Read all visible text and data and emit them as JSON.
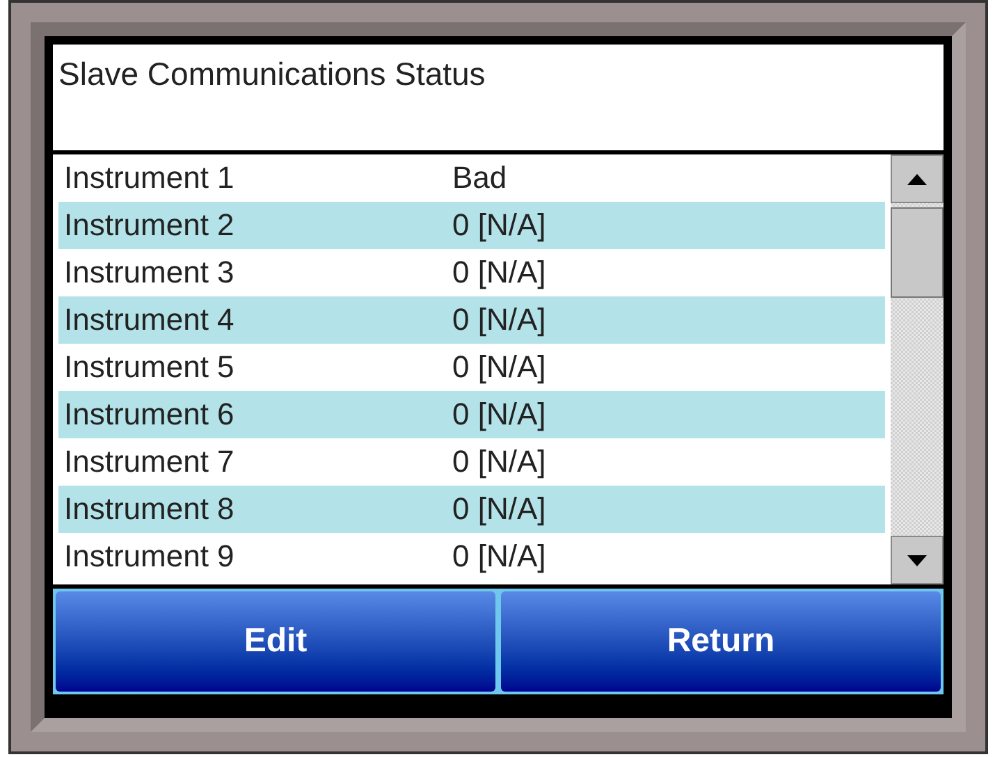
{
  "title": "Slave Communications Status",
  "rows": [
    {
      "name": "Instrument 1",
      "status": "Bad"
    },
    {
      "name": "Instrument 2",
      "status": "0 [N/A]"
    },
    {
      "name": "Instrument 3",
      "status": "0 [N/A]"
    },
    {
      "name": "Instrument 4",
      "status": "0 [N/A]"
    },
    {
      "name": "Instrument 5",
      "status": "0 [N/A]"
    },
    {
      "name": "Instrument 6",
      "status": "0 [N/A]"
    },
    {
      "name": "Instrument 7",
      "status": "0 [N/A]"
    },
    {
      "name": "Instrument 8",
      "status": "0 [N/A]"
    },
    {
      "name": "Instrument 9",
      "status": "0 [N/A]"
    }
  ],
  "buttons": [
    "Edit",
    "Return"
  ]
}
